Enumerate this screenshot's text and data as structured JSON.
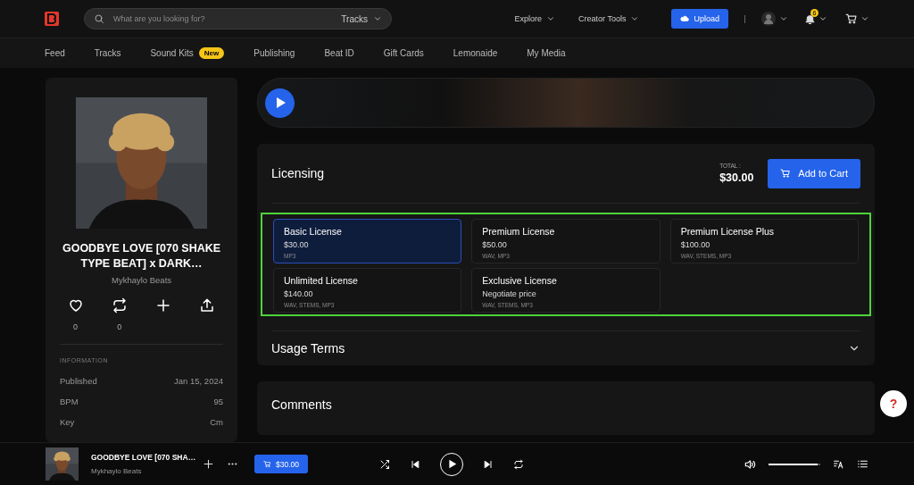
{
  "header": {
    "search": {
      "placeholder": "What are you looking for?",
      "scope": "Tracks"
    },
    "menus": [
      "Explore",
      "Creator Tools"
    ],
    "upload": "Upload",
    "notifications": "6"
  },
  "nav": [
    {
      "label": "Feed"
    },
    {
      "label": "Tracks"
    },
    {
      "label": "Sound Kits",
      "badge": "New"
    },
    {
      "label": "Publishing"
    },
    {
      "label": "Beat ID"
    },
    {
      "label": "Gift Cards"
    },
    {
      "label": "Lemonaide"
    },
    {
      "label": "My Media"
    }
  ],
  "track": {
    "title": "GOODBYE LOVE [070 SHAKE TYPE BEAT] x DARK…",
    "artist": "Mykhaylo Beats",
    "actions": [
      {
        "kind": "like",
        "count": "0"
      },
      {
        "kind": "repost",
        "count": "0"
      },
      {
        "kind": "add"
      },
      {
        "kind": "share"
      }
    ],
    "info_heading": "INFORMATION",
    "info": [
      {
        "label": "Published",
        "value": "Jan 15, 2024"
      },
      {
        "label": "BPM",
        "value": "95"
      },
      {
        "label": "Key",
        "value": "Cm"
      }
    ]
  },
  "licensing": {
    "title": "Licensing",
    "total_label": "TOTAL :",
    "total": "$30.00",
    "add_to_cart": "Add to Cart",
    "licenses": [
      {
        "name": "Basic License",
        "price": "$30.00",
        "formats": "MP3",
        "selected": true
      },
      {
        "name": "Premium License",
        "price": "$50.00",
        "formats": "WAV, MP3",
        "selected": false
      },
      {
        "name": "Premium License Plus",
        "price": "$100.00",
        "formats": "WAV, STEMS, MP3",
        "selected": false
      },
      {
        "name": "Unlimited License",
        "price": "$140.00",
        "formats": "WAV, STEMS, MP3",
        "selected": false
      },
      {
        "name": "Exclusive License",
        "price": "Negotiate price",
        "formats": "WAV, STEMS, MP3",
        "selected": false
      }
    ]
  },
  "usage_terms": "Usage Terms",
  "comments": "Comments",
  "help": "?",
  "player": {
    "title": "GOODBYE LOVE [070 SHA…",
    "artist": "Mykhaylo Beats",
    "price": "$30.00",
    "volume": {
      "level": 0.95
    }
  }
}
